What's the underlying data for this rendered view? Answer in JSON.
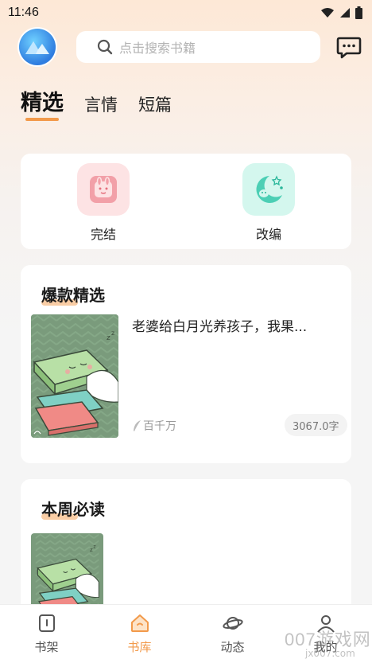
{
  "status_bar": {
    "time": "11:46"
  },
  "search": {
    "placeholder": "点击搜索书籍"
  },
  "tabs": [
    {
      "label": "精选",
      "active": true
    },
    {
      "label": "言情",
      "active": false
    },
    {
      "label": "短篇",
      "active": false
    }
  ],
  "categories": [
    {
      "label": "完结",
      "icon": "bunny-icon",
      "color": "#f2a0a8"
    },
    {
      "label": "改编",
      "icon": "moon-icon",
      "color": "#4ccfb5"
    }
  ],
  "sections": [
    {
      "title": "爆款精选",
      "book": {
        "title": "老婆给白月光养孩子，我果...",
        "author": "百千万",
        "words": "3067.0字"
      }
    },
    {
      "title": "本周必读"
    }
  ],
  "bottom_nav": [
    {
      "label": "书架",
      "icon": "bookshelf-icon",
      "active": false
    },
    {
      "label": "书库",
      "icon": "library-icon",
      "active": true
    },
    {
      "label": "动态",
      "icon": "planet-icon",
      "active": false
    },
    {
      "label": "我的",
      "icon": "profile-icon",
      "active": false
    }
  ],
  "watermark": {
    "text": "007游戏网",
    "sub": "jx007.com"
  },
  "colors": {
    "accent": "#f29a4b",
    "cover_green": "#7a9b7c"
  }
}
